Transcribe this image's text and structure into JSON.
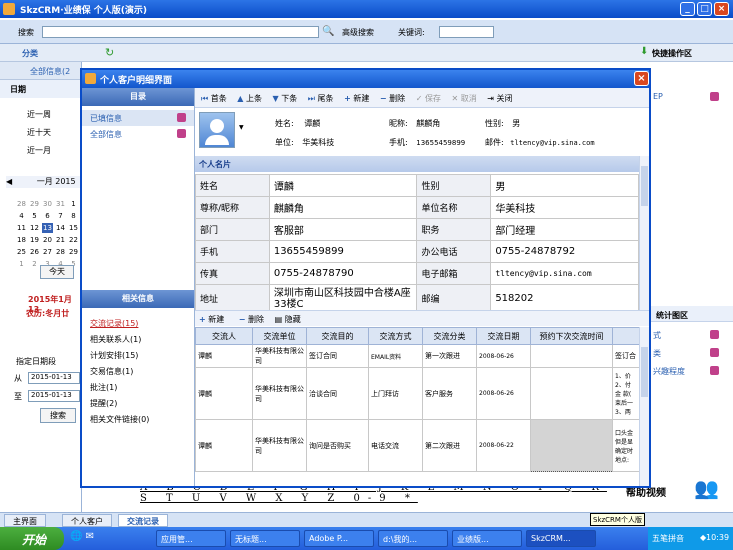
{
  "app": {
    "title": "SkzCRM·业绩保 个人版(演示)",
    "win_buttons": [
      "_",
      "□",
      "×"
    ]
  },
  "toolbar": {
    "search_label": "搜索",
    "search_value": "",
    "advanced_search": "高级搜索",
    "keyword_label": "关键词:",
    "keyword_value": ""
  },
  "bar2": {
    "category": "分类",
    "shortcut": "快捷操作区"
  },
  "left": {
    "all_info": "全部信息(2",
    "date_head": "日期",
    "ranges": [
      "近一周",
      "近十天",
      "近一月"
    ],
    "month_label": "一月 2015",
    "cal_rows": [
      [
        "28",
        "29",
        "30",
        "31",
        "1"
      ],
      [
        "4",
        "5",
        "6",
        "7",
        "8"
      ],
      [
        "11",
        "12",
        "13",
        "14",
        "15"
      ],
      [
        "18",
        "19",
        "20",
        "21",
        "22"
      ],
      [
        "25",
        "26",
        "27",
        "28",
        "29"
      ],
      [
        "1",
        "2",
        "3",
        "4",
        "5"
      ]
    ],
    "today_btn": "今天",
    "date_red": "2015年1月13",
    "lunar": "农历:冬月廿",
    "range_title": "指定日期段",
    "from_label": "从",
    "to_label": "至",
    "from_value": "2015-01-13",
    "to_value": "2015-01-13",
    "search_btn": "搜索"
  },
  "right": {
    "items": [
      "式",
      "类",
      "兴趣程度"
    ],
    "stat_head": "统计图区",
    "ep": "EP",
    "help": "帮助视频"
  },
  "dialog": {
    "title": "个人客户明细界面",
    "catalog": "目录",
    "catalog_items": [
      "已填信息",
      "全部信息"
    ],
    "related_head": "相关信息",
    "related_items": [
      "交流记录(15)",
      "相关联系人(1)",
      "计划安排(15)",
      "交易信息(1)",
      "批注(1)",
      "提醒(2)",
      "相关文件链接(0)"
    ],
    "nav": [
      "首条",
      "上条",
      "下条",
      "尾条",
      "新建",
      "删除",
      "保存",
      "取消",
      "关闭"
    ],
    "summary": {
      "name_l": "姓名:",
      "name_v": "谭麟",
      "nick_l": "昵称:",
      "nick_v": "麒麟角",
      "gender_l": "性别:",
      "gender_v": "男",
      "unit_l": "单位:",
      "unit_v": "华美科技",
      "mobile_l": "手机:",
      "mobile_v": "13655459899",
      "email_l": "邮件:",
      "email_v": "tltency@vip.sina.com"
    },
    "card_head": "个人名片",
    "card": [
      [
        "姓名",
        "谭麟",
        "性别",
        "男"
      ],
      [
        "尊称/昵称",
        "麒麟角",
        "单位名称",
        "华美科技"
      ],
      [
        "部门",
        "客服部",
        "职务",
        "部门经理"
      ],
      [
        "手机",
        "13655459899",
        "办公电话",
        "0755-24878792"
      ],
      [
        "传真",
        "0755-24878790",
        "电子邮箱",
        "tltency@vip.sina.com"
      ],
      [
        "地址",
        "深圳市南山区科技园中合楼A座33楼C",
        "邮编",
        "518202"
      ]
    ],
    "sub_tb": [
      "新建",
      "删除",
      "隐藏"
    ],
    "columns": [
      "交流人",
      "交流单位",
      "交流目的",
      "交流方式",
      "交流分类",
      "交流日期",
      "预约下次交流时间",
      ""
    ],
    "rows": [
      [
        "谭麟",
        "华美科技有限公司",
        "签订合同",
        "EMAIL资料",
        "第一次跟进",
        "2008-06-26",
        "",
        "签订合"
      ],
      [
        "谭麟",
        "华美科技有限公司",
        "洽谈合同",
        "上门拜访",
        "客户服务",
        "2008-06-26",
        "",
        "1、价 2、付 金 款( 束后一 3、两"
      ],
      [
        "谭麟",
        "华美科技有限公司",
        "询问是否购买",
        "电话交流",
        "第二次跟进",
        "2008-06-22",
        "",
        "口头金 但是显 确定时 地点:"
      ]
    ]
  },
  "alphabet": "A B C D E F G H I J K L M N O P Q R S T U V W X Y Z 0-9 *",
  "status_tabs": [
    "主界面",
    "个人客户",
    "交流记录"
  ],
  "taskbar": {
    "start": "开始",
    "tasks": [
      "应用管...",
      "无标题...",
      "Adobe P...",
      "d:\\我的...",
      "业绩版...",
      "SkzCRM..."
    ],
    "ime": "五笔拼音",
    "clock": "10:39",
    "tip": "SkzCRM个人版"
  }
}
